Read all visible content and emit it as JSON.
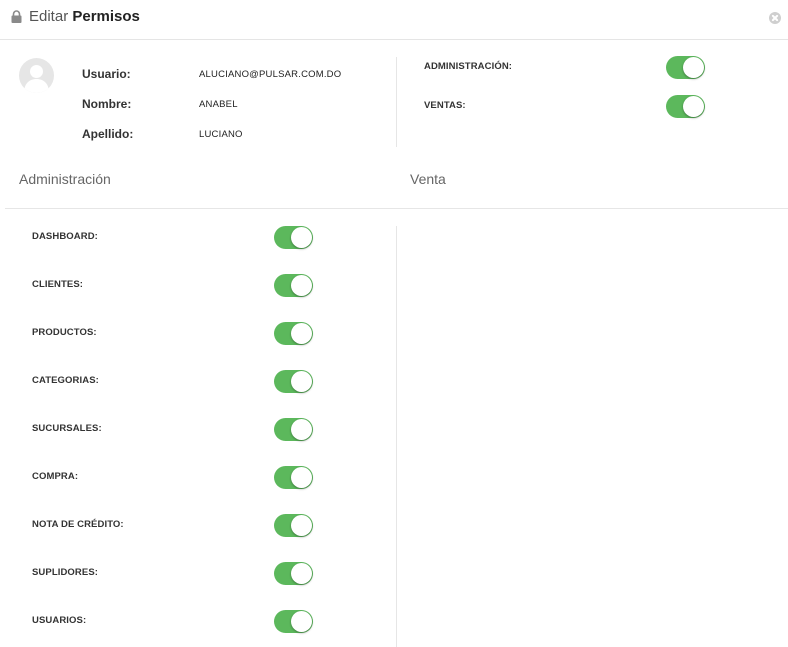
{
  "header": {
    "title_prefix": "Editar",
    "title_main": "Permisos",
    "lock_icon": "lock-icon",
    "close_icon": "close-icon"
  },
  "user": {
    "avatar_icon": "user-avatar-icon",
    "fields": [
      {
        "label": "Usuario:",
        "value": "ALUCIANO@PULSAR.COM.DO"
      },
      {
        "label": "Nombre:",
        "value": "ANABEL"
      },
      {
        "label": "Apellido:",
        "value": "LUCIANO"
      }
    ]
  },
  "modules": [
    {
      "label": "ADMINISTRACIÓN:",
      "enabled": true
    },
    {
      "label": "VENTAS:",
      "enabled": true
    }
  ],
  "sections": {
    "admin_title": "Administración",
    "venta_title": "Venta"
  },
  "admin_permissions": [
    {
      "label": "DASHBOARD:",
      "enabled": true
    },
    {
      "label": "CLIENTES:",
      "enabled": true
    },
    {
      "label": "PRODUCTOS:",
      "enabled": true
    },
    {
      "label": "CATEGORIAS:",
      "enabled": true
    },
    {
      "label": "SUCURSALES:",
      "enabled": true
    },
    {
      "label": "COMPRA:",
      "enabled": true
    },
    {
      "label": "NOTA DE CRÉDITO:",
      "enabled": true
    },
    {
      "label": "SUPLIDORES:",
      "enabled": true
    },
    {
      "label": "USUARIOS:",
      "enabled": true
    }
  ],
  "colors": {
    "toggle_on": "#5cb85c",
    "toggle_off": "#d9d9d9",
    "divider": "#e6e6e6"
  }
}
